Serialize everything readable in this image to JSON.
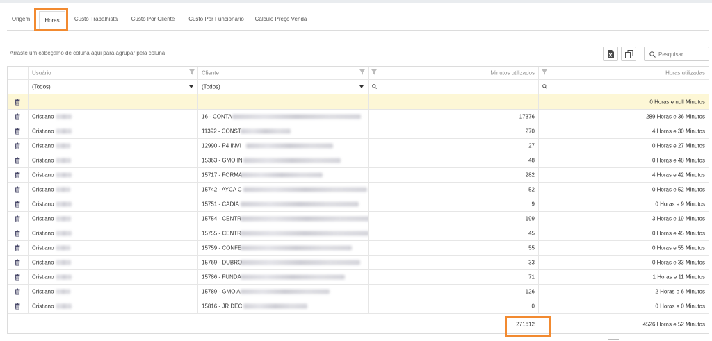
{
  "tabs": [
    {
      "label": "Origem"
    },
    {
      "label": "Horas",
      "active": true
    },
    {
      "label": "Custo Trabalhista"
    },
    {
      "label": "Custo Por Cliente"
    },
    {
      "label": "Custo Por Funcionário"
    },
    {
      "label": "Cálculo Preço Venda"
    }
  ],
  "toolbar": {
    "group_hint": "Arraste um cabeçalho de coluna aqui para agrupar pela coluna",
    "search_placeholder": "Pesquisar"
  },
  "grid": {
    "columns": {
      "usuario": "Usuário",
      "cliente": "Cliente",
      "minutos": "Minutos utilizados",
      "horas": "Horas utilizadas"
    },
    "filters": {
      "usuario": "(Todos)",
      "cliente": "(Todos)"
    },
    "new_row": {
      "horas": "0 Horas e null Minutos"
    },
    "rows": [
      {
        "usuario": "Cristiano",
        "cliente": "16 - CONTA",
        "minutos": "17376",
        "horas": "289 Horas e 36 Minutos"
      },
      {
        "usuario": "Cristiano",
        "cliente": "11392 - CONST",
        "minutos": "270",
        "horas": "4 Horas e 30 Minutos"
      },
      {
        "usuario": "Cristiano",
        "cliente": "12990 - P4 INVI",
        "minutos": "27",
        "horas": "0 Horas e 27 Minutos"
      },
      {
        "usuario": "Cristiano",
        "cliente": "15363 - GMO IN",
        "minutos": "48",
        "horas": "0 Horas e 48 Minutos"
      },
      {
        "usuario": "Cristiano",
        "cliente": "15717 - FORMA",
        "minutos": "282",
        "horas": "4 Horas e 42 Minutos"
      },
      {
        "usuario": "Cristiano",
        "cliente": "15742 - AYCA C",
        "minutos": "52",
        "horas": "0 Horas e 52 Minutos"
      },
      {
        "usuario": "Cristiano",
        "cliente": "15751 - CADIA",
        "minutos": "9",
        "horas": "0 Horas e 9 Minutos"
      },
      {
        "usuario": "Cristiano",
        "cliente": "15754 - CENTR",
        "minutos": "199",
        "horas": "3 Horas e 19 Minutos"
      },
      {
        "usuario": "Cristiano",
        "cliente": "15755 - CENTR",
        "minutos": "45",
        "horas": "0 Horas e 45 Minutos"
      },
      {
        "usuario": "Cristiano",
        "cliente": "15759 - CONFE",
        "minutos": "55",
        "horas": "0 Horas e 55 Minutos"
      },
      {
        "usuario": "Cristiano",
        "cliente": "15769 - DUBRO",
        "minutos": "33",
        "horas": "0 Horas e 33 Minutos"
      },
      {
        "usuario": "Cristiano",
        "cliente": "15786 - FUNDA",
        "minutos": "71",
        "horas": "1 Horas e 11 Minutos"
      },
      {
        "usuario": "Cristiano",
        "cliente": "15789 - GMO A",
        "minutos": "126",
        "horas": "2 Horas e 6 Minutos"
      },
      {
        "usuario": "Cristiano",
        "cliente": "15816 - JR DEC",
        "minutos": "0",
        "horas": "0 Horas e 0 Minutos"
      }
    ],
    "totals": {
      "minutos": "271612",
      "horas": "4526 Horas e 52 Minutos"
    }
  },
  "colors": {
    "highlight": "#f28a30",
    "new_row_bg": "#fdf7d6",
    "icon": "#4a4a6a"
  },
  "icons": [
    "trash-icon",
    "funnel-icon",
    "search-icon",
    "export-excel-icon",
    "column-chooser-icon",
    "dropdown-caret-icon"
  ]
}
